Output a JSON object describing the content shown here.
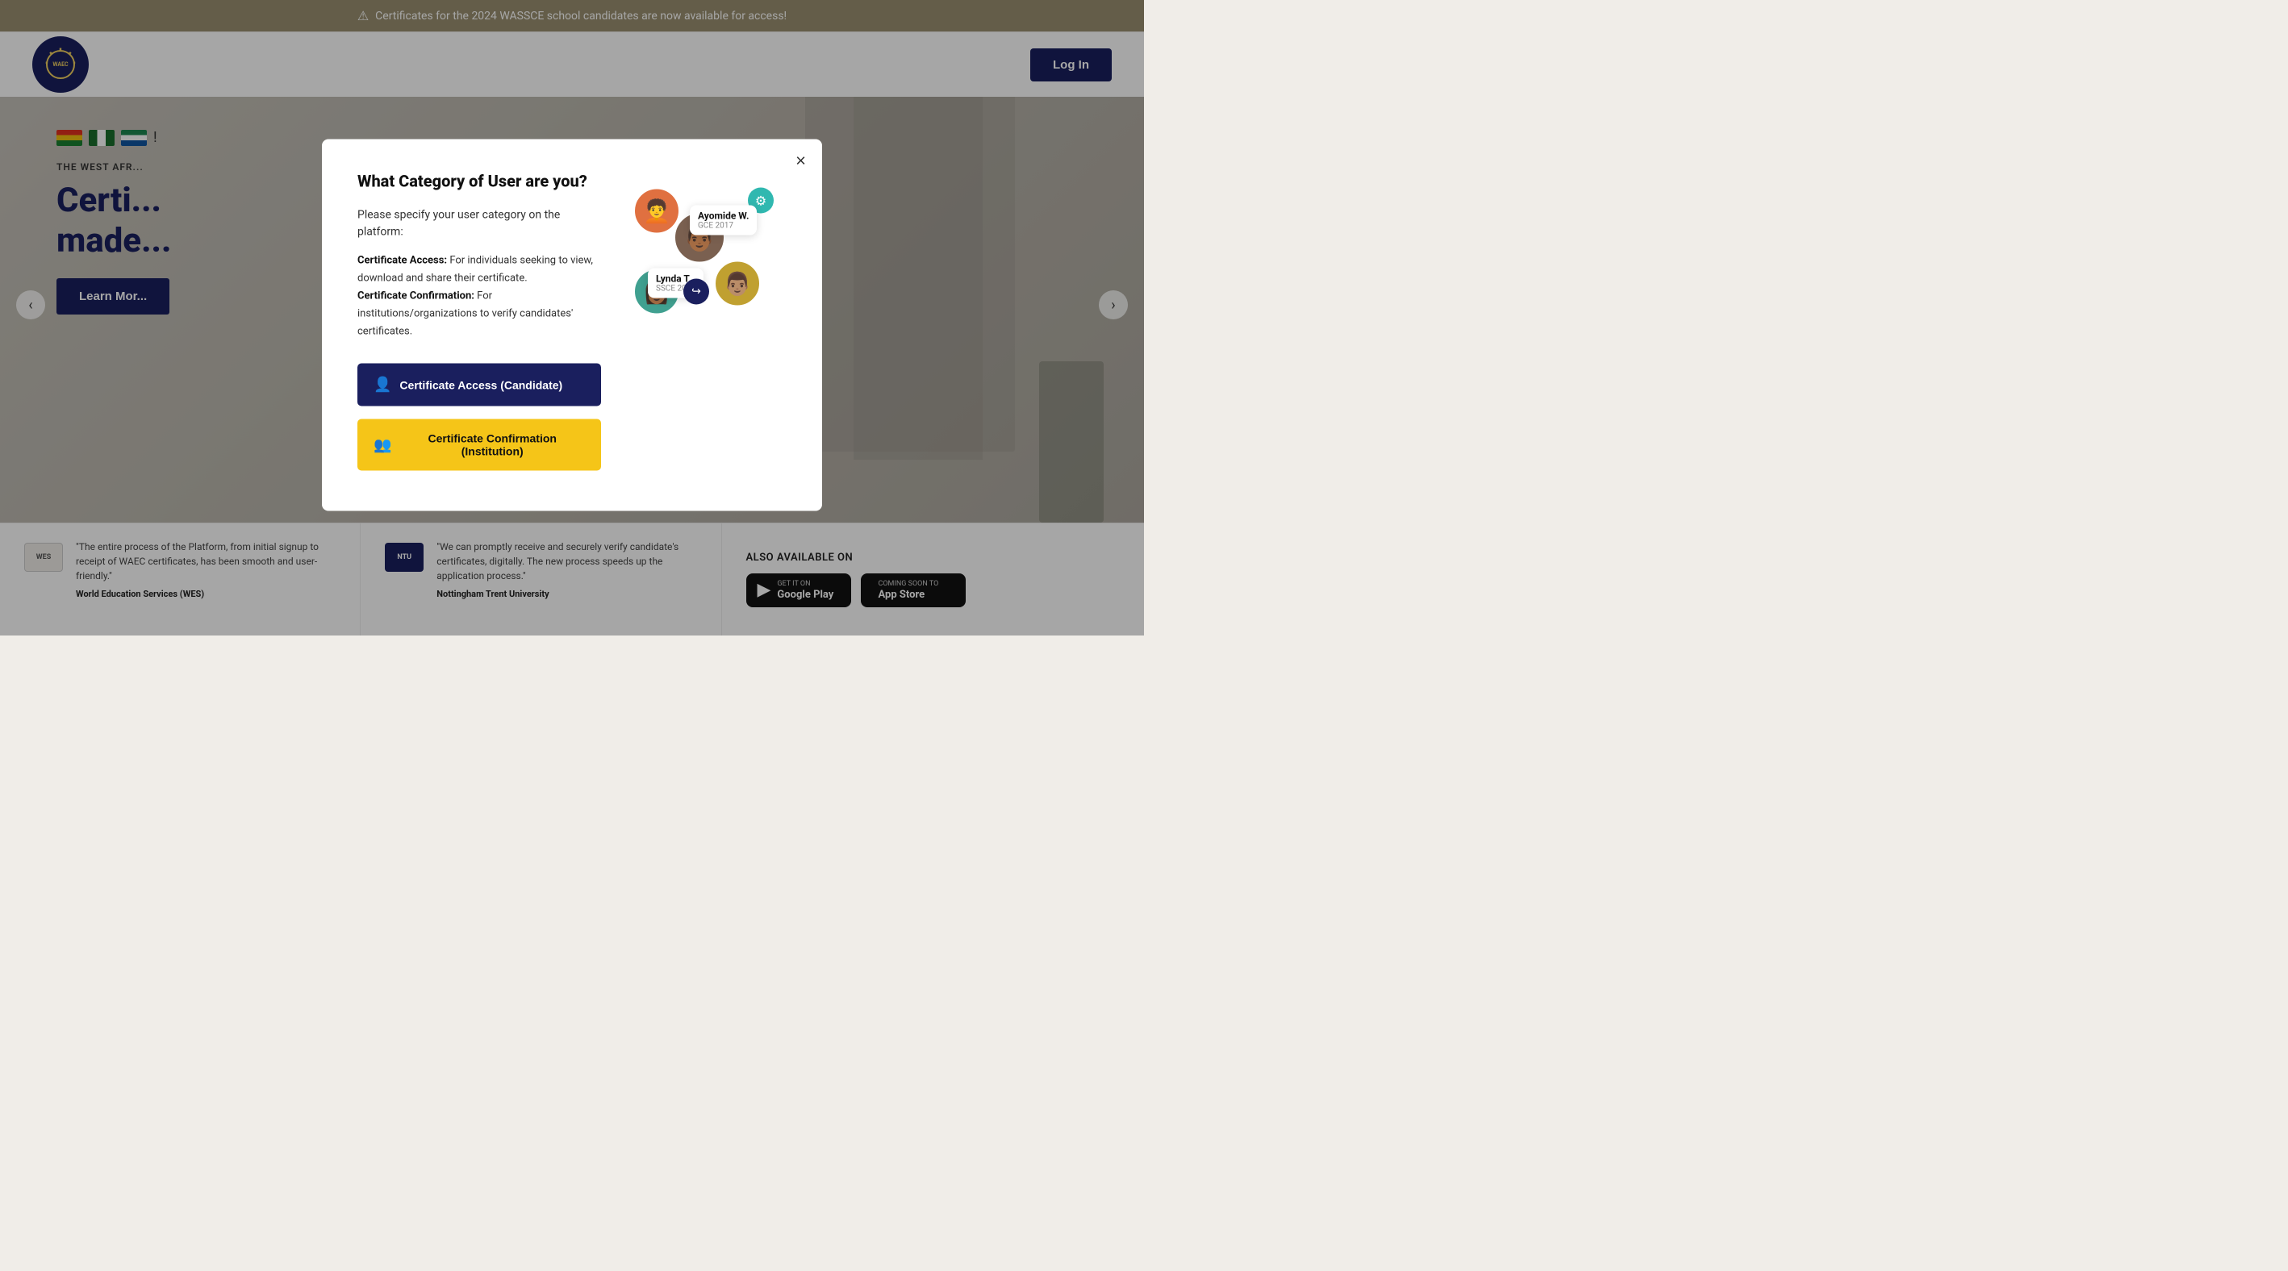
{
  "announcement": {
    "text": "Certificates for the 2024 WASSCE school candidates are now available for access!",
    "icon": "⚠"
  },
  "navbar": {
    "login_label": "Log In"
  },
  "hero": {
    "subtitle": "THE WEST AFR...",
    "title": "Certi...\nmade...",
    "cta_label": "Learn Mor..."
  },
  "modal": {
    "title": "What Category of User are you?",
    "subtitle": "Please specify your user category on the platform:",
    "description_candidate_label": "Certificate Access:",
    "description_candidate_text": " For individuals seeking to view, download and share their certificate.",
    "description_institution_label": "Certificate Confirmation:",
    "description_institution_text": " For institutions/organizations to verify candidates' certificates.",
    "btn_candidate_label": "Certificate Access (Candidate)",
    "btn_institution_label": "Certificate Confirmation (Institution)",
    "close_label": "×",
    "avatar1_name": "Ayomide W.",
    "avatar1_sub": "GCE 2017",
    "avatar2_name": "Lynda T.",
    "avatar2_sub": "SSCE 2017"
  },
  "footer": {
    "also_available_label": "ALSO AVAILABLE ON",
    "google_play_get": "GET IT ON",
    "google_play_name": "Google Play",
    "app_store_get": "COMING SOON TO",
    "app_store_name": "App Store",
    "testimonial1_quote": "\"The entire process of the Platform, from initial signup to receipt of WAEC certificates, has been smooth and user-friendly.\"",
    "testimonial1_source": "World Education Services (WES)",
    "testimonial2_quote": "\"We can promptly receive and securely verify candidate's certificates, digitally. The new process speeds up the application process.\"",
    "testimonial2_source": "Nottingham Trent University",
    "wes_logo": "WES",
    "ntu_logo": "NTU"
  }
}
